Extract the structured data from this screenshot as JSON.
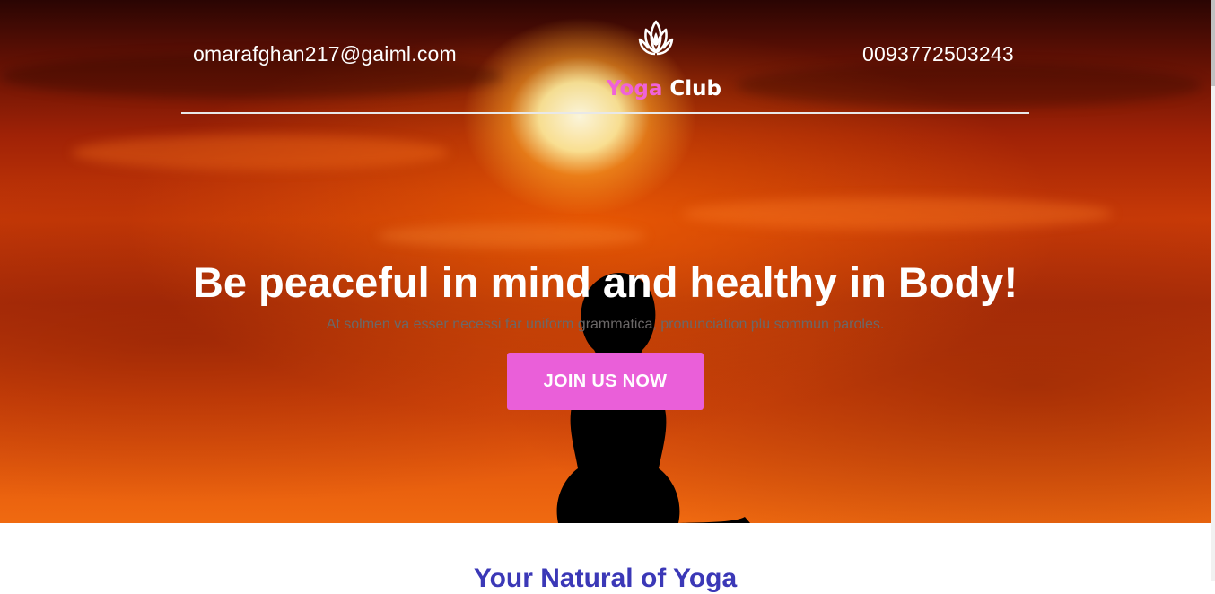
{
  "header": {
    "email": "omarafghan217@gaiml.com",
    "phone": "0093772503243",
    "logo": {
      "word1": "Yoga",
      "word2": "Club",
      "icon": "lotus-icon"
    }
  },
  "hero": {
    "headline": "Be peaceful in mind and healthy in Body!",
    "subtext": "At solmen va esser necessi far uniform grammatica, pronunciation plu sommun paroles.",
    "cta_label": "JOIN US NOW"
  },
  "section": {
    "title": "Your Natural of Yoga"
  },
  "colors": {
    "accent_pink": "#ea5fd9",
    "logo_pink": "#f062d8",
    "section_title_blue": "#3b38b7"
  }
}
